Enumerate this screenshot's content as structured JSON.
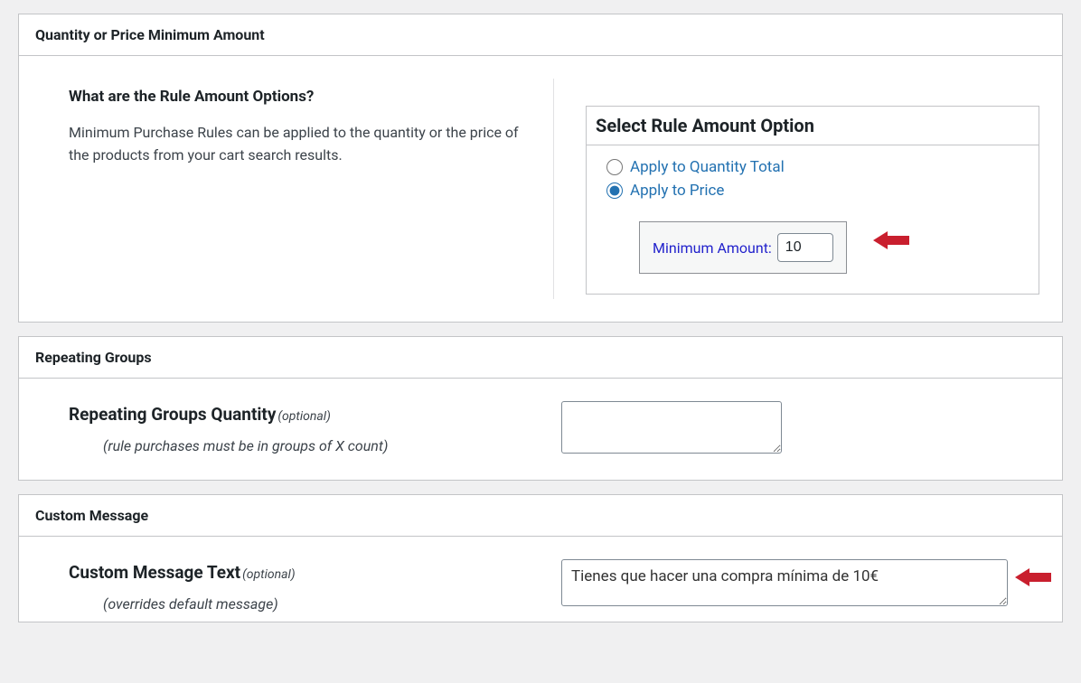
{
  "panel1": {
    "header": "Quantity or Price Minimum Amount",
    "question": "What are the Rule Amount Options?",
    "description": "Minimum Purchase Rules can be applied to the quantity or the price of the products from your cart search results.",
    "fieldset_title": "Select Rule Amount Option",
    "radio_quantity": "Apply to Quantity Total",
    "radio_price": "Apply to Price",
    "min_amount_label": "Minimum Amount:",
    "min_amount_value": "10"
  },
  "panel2": {
    "header": "Repeating Groups",
    "label": "Repeating Groups Quantity",
    "optional": "(optional)",
    "hint": "(rule purchases must be in groups of X count)",
    "value": ""
  },
  "panel3": {
    "header": "Custom Message",
    "label": "Custom Message Text",
    "optional": "(optional)",
    "hint": "(overrides default message)",
    "value": "Tienes que hacer una compra mínima de 10€"
  }
}
